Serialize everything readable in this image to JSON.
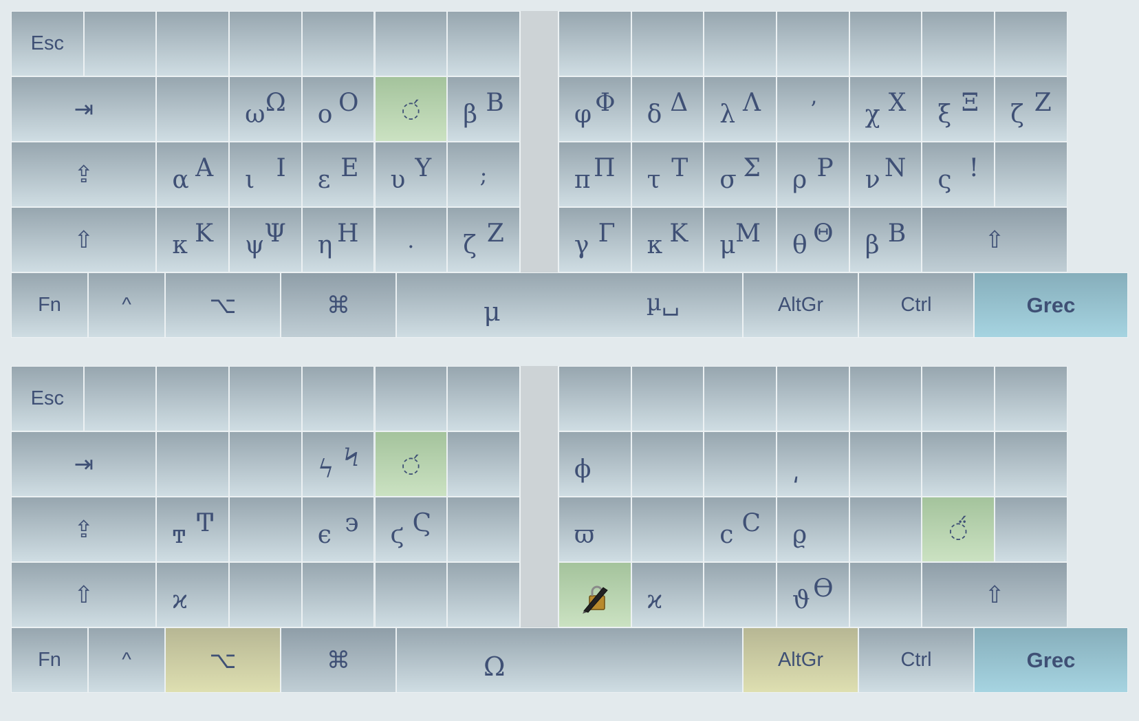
{
  "boards": [
    {
      "rows": [
        [
          {
            "w": 1,
            "kind": "func",
            "label": "Esc"
          },
          {
            "w": 1
          },
          {
            "w": 1
          },
          {
            "w": 1
          },
          {
            "w": 1
          },
          {
            "w": 1
          },
          {
            "w": 1
          },
          {
            "gap": true
          },
          {
            "w": 1
          },
          {
            "w": 1
          },
          {
            "w": 1
          },
          {
            "w": 1
          },
          {
            "w": 1
          },
          {
            "w": 1
          },
          {
            "w": 1
          }
        ],
        [
          {
            "w": 2,
            "kind": "icon",
            "icon": "tab-icon",
            "label": "⇥"
          },
          {
            "w": 1
          },
          {
            "w": 1,
            "lower": "ω",
            "upper": "Ω"
          },
          {
            "w": 1,
            "lower": "ο",
            "upper": "Ο"
          },
          {
            "w": 1,
            "style": "green",
            "mid": "◌́"
          },
          {
            "w": 1,
            "lower": "β",
            "upper": "Β"
          },
          {
            "gap": true
          },
          {
            "w": 1,
            "lower": "φ",
            "upper": "Φ"
          },
          {
            "w": 1,
            "lower": "δ",
            "upper": "Δ"
          },
          {
            "w": 1,
            "lower": "λ",
            "upper": "Λ"
          },
          {
            "w": 1,
            "mid": "ʼ"
          },
          {
            "w": 1,
            "lower": "χ",
            "upper": "Χ"
          },
          {
            "w": 1,
            "lower": "ξ",
            "upper": "Ξ"
          },
          {
            "w": 1,
            "lower": "ζ",
            "upper": "Ζ"
          }
        ],
        [
          {
            "w": 2,
            "kind": "icon",
            "icon": "caps-lock-icon",
            "label": "⇪"
          },
          {
            "w": 1,
            "lower": "α",
            "upper": "Α"
          },
          {
            "w": 1,
            "lower": "ι",
            "upper": "Ι"
          },
          {
            "w": 1,
            "lower": "ε",
            "upper": "Ε"
          },
          {
            "w": 1,
            "lower": "υ",
            "upper": "Υ"
          },
          {
            "w": 1,
            "mid": ";"
          },
          {
            "gap": true
          },
          {
            "w": 1,
            "lower": "π",
            "upper": "Π"
          },
          {
            "w": 1,
            "lower": "τ",
            "upper": "Τ"
          },
          {
            "w": 1,
            "lower": "σ",
            "upper": "Σ"
          },
          {
            "w": 1,
            "lower": "ρ",
            "upper": "Ρ"
          },
          {
            "w": 1,
            "lower": "ν",
            "upper": "Ν"
          },
          {
            "w": 1,
            "lower": "ς",
            "upper": "!"
          },
          {
            "w": 1
          }
        ],
        [
          {
            "w": 2,
            "kind": "icon",
            "icon": "shift-icon",
            "label": "⇧"
          },
          {
            "w": 1,
            "lower": "κ",
            "upper": "Κ"
          },
          {
            "w": 1,
            "lower": "ψ",
            "upper": "Ψ"
          },
          {
            "w": 1,
            "lower": "η",
            "upper": "Η"
          },
          {
            "w": 1,
            "mid": "."
          },
          {
            "w": 1,
            "lower": "ζ",
            "upper": "Ζ"
          },
          {
            "gap": true
          },
          {
            "w": 1,
            "lower": "γ",
            "upper": "Γ"
          },
          {
            "w": 1,
            "lower": "κ",
            "upper": "Κ"
          },
          {
            "w": 1,
            "lower": "μ",
            "upper": "Μ"
          },
          {
            "w": 1,
            "lower": "θ",
            "upper": "Θ"
          },
          {
            "w": 1,
            "lower": "β",
            "upper": "Β"
          },
          {
            "w": 2,
            "kind": "icon",
            "icon": "shift-icon",
            "label": "⇧",
            "style": "dark"
          }
        ],
        [
          {
            "w": 1,
            "kind": "func",
            "label": "Fn"
          },
          {
            "w": 1,
            "kind": "func",
            "label": "^"
          },
          {
            "w": 1.5,
            "kind": "icon",
            "icon": "option-icon",
            "label": "⌥"
          },
          {
            "w": 1.5,
            "kind": "icon",
            "icon": "command-icon",
            "label": "⌘",
            "style": "dark"
          },
          {
            "w": 4.5,
            "kind": "space",
            "label": "μ",
            "label2": "µ␣"
          },
          {
            "w": 1.5,
            "kind": "func",
            "label": "AltGr"
          },
          {
            "w": 1.5,
            "kind": "func",
            "label": "Ctrl"
          },
          {
            "w": 2,
            "kind": "func",
            "label": "Grec",
            "style": "teal",
            "bold": true
          }
        ]
      ]
    },
    {
      "rows": [
        [
          {
            "w": 1,
            "kind": "func",
            "label": "Esc"
          },
          {
            "w": 1
          },
          {
            "w": 1
          },
          {
            "w": 1
          },
          {
            "w": 1
          },
          {
            "w": 1
          },
          {
            "w": 1
          },
          {
            "gap": true
          },
          {
            "w": 1
          },
          {
            "w": 1
          },
          {
            "w": 1
          },
          {
            "w": 1
          },
          {
            "w": 1
          },
          {
            "w": 1
          },
          {
            "w": 1
          }
        ],
        [
          {
            "w": 2,
            "kind": "icon",
            "icon": "tab-icon",
            "label": "⇥"
          },
          {
            "w": 1
          },
          {
            "w": 1
          },
          {
            "w": 1,
            "lower": "ϟ",
            "upper": "Ϟ"
          },
          {
            "w": 1,
            "style": "green",
            "mid": "◌́"
          },
          {
            "w": 1
          },
          {
            "gap": true
          },
          {
            "w": 1,
            "lower": "ϕ"
          },
          {
            "w": 1
          },
          {
            "w": 1
          },
          {
            "w": 1,
            "lower": "͵"
          },
          {
            "w": 1
          },
          {
            "w": 1
          },
          {
            "w": 1
          }
        ],
        [
          {
            "w": 2,
            "kind": "icon",
            "icon": "caps-lock-icon",
            "label": "⇪"
          },
          {
            "w": 1,
            "lower": "ͳ",
            "upper": "Ͳ"
          },
          {
            "w": 1
          },
          {
            "w": 1,
            "lower": "ϵ",
            "upper": "϶"
          },
          {
            "w": 1,
            "lower": "ϛ",
            "upper": "Ϛ"
          },
          {
            "w": 1
          },
          {
            "gap": true
          },
          {
            "w": 1,
            "lower": "ϖ"
          },
          {
            "w": 1
          },
          {
            "w": 1,
            "lower": "ϲ",
            "upper": "Ϲ"
          },
          {
            "w": 1,
            "lower": "ϱ"
          },
          {
            "w": 1
          },
          {
            "w": 1,
            "style": "green",
            "mid": "◌̈́"
          },
          {
            "w": 1
          }
        ],
        [
          {
            "w": 2,
            "kind": "icon",
            "icon": "shift-icon",
            "label": "⇧"
          },
          {
            "w": 1,
            "lower": "ϰ"
          },
          {
            "w": 1
          },
          {
            "w": 1
          },
          {
            "w": 1
          },
          {
            "w": 1
          },
          {
            "gap": true
          },
          {
            "w": 1,
            "style": "green",
            "pen": true
          },
          {
            "w": 1,
            "lower": "ϰ"
          },
          {
            "w": 1
          },
          {
            "w": 1,
            "lower": "ϑ",
            "upper": "ϴ"
          },
          {
            "w": 1
          },
          {
            "w": 2,
            "kind": "icon",
            "icon": "shift-icon",
            "label": "⇧",
            "style": "dark"
          }
        ],
        [
          {
            "w": 1,
            "kind": "func",
            "label": "Fn"
          },
          {
            "w": 1,
            "kind": "func",
            "label": "^"
          },
          {
            "w": 1.5,
            "kind": "icon",
            "icon": "option-icon",
            "label": "⌥",
            "style": "yellow"
          },
          {
            "w": 1.5,
            "kind": "icon",
            "icon": "command-icon",
            "label": "⌘",
            "style": "dark"
          },
          {
            "w": 4.5,
            "kind": "space",
            "label": "Ω"
          },
          {
            "w": 1.5,
            "kind": "func",
            "label": "AltGr",
            "style": "yellow"
          },
          {
            "w": 1.5,
            "kind": "func",
            "label": "Ctrl"
          },
          {
            "w": 2,
            "kind": "func",
            "label": "Grec",
            "style": "teal",
            "bold": true
          }
        ]
      ]
    }
  ]
}
